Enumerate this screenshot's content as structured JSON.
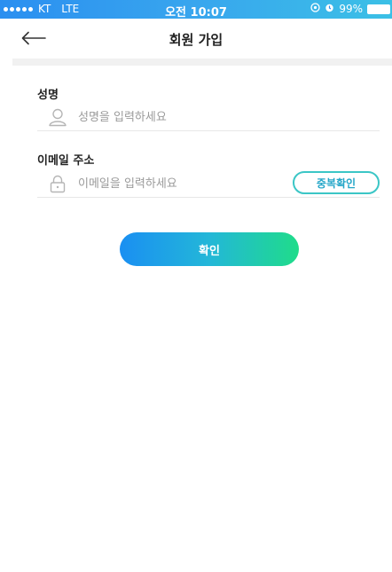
{
  "status_bar": {
    "carrier": "KT",
    "network": "LTE",
    "time": "오전 10:07",
    "battery": "99%"
  },
  "header": {
    "title": "회원 가입",
    "back_icon": "arrow-left-icon"
  },
  "form": {
    "name": {
      "label": "성명",
      "placeholder": "성명을 입력하세요",
      "icon": "user-icon"
    },
    "email": {
      "label": "이메일 주소",
      "placeholder": "이메일을 입력하세요",
      "icon": "lock-icon",
      "check_button": "중복확인"
    },
    "submit_label": "확인"
  },
  "colors": {
    "status_bar": "#2b8ff0",
    "accent_start": "#1a8ff2",
    "accent_end": "#1fdc8a",
    "outline_button": "#3bc6c6"
  }
}
